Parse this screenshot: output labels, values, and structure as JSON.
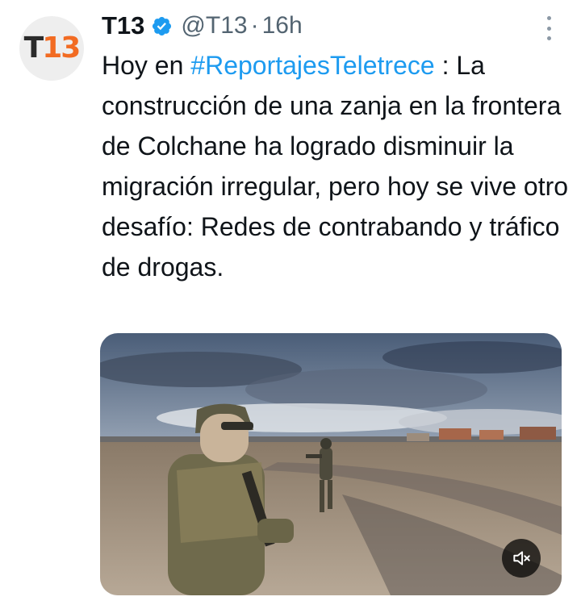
{
  "tweet": {
    "author": {
      "name": "T13",
      "handle": "@T13",
      "separator": "·",
      "time": "16h",
      "avatar_text_a": "T",
      "avatar_text_b": "13",
      "verified": true
    },
    "text": {
      "prefix": "Hoy en ",
      "hashtag": "#ReportajesTeletrece",
      "suffix": " : La construcción de una zanja en la frontera de Colchane ha logrado disminuir la migración irregular, pero hoy se vive otro desafío: Redes de contrabando y tráfico de drogas."
    },
    "media": {
      "type": "video",
      "muted": true
    }
  },
  "colors": {
    "hashtag": "#1d9bf0",
    "verified": "#1d9bf0",
    "secondary_text": "#536471",
    "logo_orange": "#f26b22"
  },
  "icons": {
    "verified": "verified-badge-icon",
    "more": "more-options-icon",
    "mute": "volume-muted-icon"
  }
}
